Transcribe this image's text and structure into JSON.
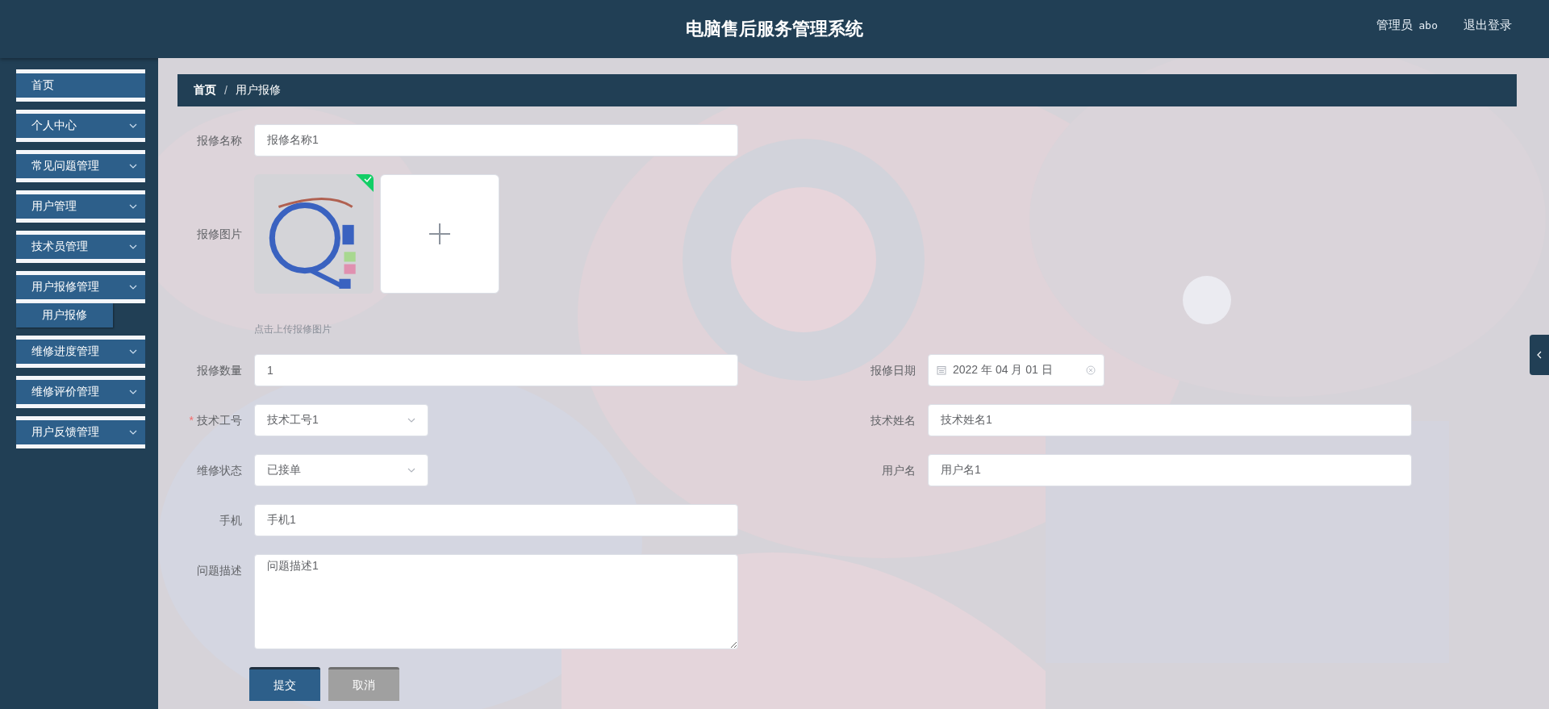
{
  "header": {
    "title": "电脑售后服务管理系统",
    "user_label": "管理员",
    "username": "abo",
    "logout": "退出登录"
  },
  "sidebar": {
    "items": [
      {
        "label": "首页",
        "kind": "link"
      },
      {
        "label": "个人中心",
        "kind": "menu"
      },
      {
        "label": "常见问题管理",
        "kind": "menu"
      },
      {
        "label": "用户管理",
        "kind": "menu"
      },
      {
        "label": "技术员管理",
        "kind": "menu"
      },
      {
        "label": "用户报修管理",
        "kind": "menu",
        "children": [
          {
            "label": "用户报修"
          }
        ]
      },
      {
        "label": "维修进度管理",
        "kind": "menu"
      },
      {
        "label": "维修评价管理",
        "kind": "menu"
      },
      {
        "label": "用户反馈管理",
        "kind": "menu"
      }
    ]
  },
  "breadcrumb": {
    "separator": "/",
    "items": [
      "首页",
      "用户报修"
    ]
  },
  "form": {
    "rows": [
      {
        "left": {
          "kind": "text",
          "label": "报修名称",
          "value": "报修名称1"
        }
      },
      {
        "left": {
          "kind": "upload",
          "label": "报修图片",
          "hint": "点击上传报修图片",
          "uploaded": true
        }
      },
      {
        "left": {
          "kind": "text",
          "label": "报修数量",
          "value": "1"
        },
        "right": {
          "kind": "date",
          "label": "报修日期",
          "value": "2022 年 04 月 01 日"
        }
      },
      {
        "left": {
          "kind": "select",
          "label": "技术工号",
          "value": "技术工号1",
          "required_mark": "*"
        },
        "right": {
          "kind": "text",
          "label": "技术姓名",
          "value": "技术姓名1"
        }
      },
      {
        "left": {
          "kind": "select",
          "label": "维修状态",
          "value": "已接单"
        },
        "right": {
          "kind": "text",
          "label": "用户名",
          "value": "用户名1"
        }
      },
      {
        "left": {
          "kind": "text",
          "label": "手机",
          "value": "手机1"
        }
      },
      {
        "left": {
          "kind": "textarea",
          "label": "问题描述",
          "value": "问题描述1"
        }
      }
    ],
    "buttons": [
      {
        "label": "提交",
        "kind": "primary"
      },
      {
        "label": "取消",
        "kind": "secondary"
      }
    ]
  }
}
